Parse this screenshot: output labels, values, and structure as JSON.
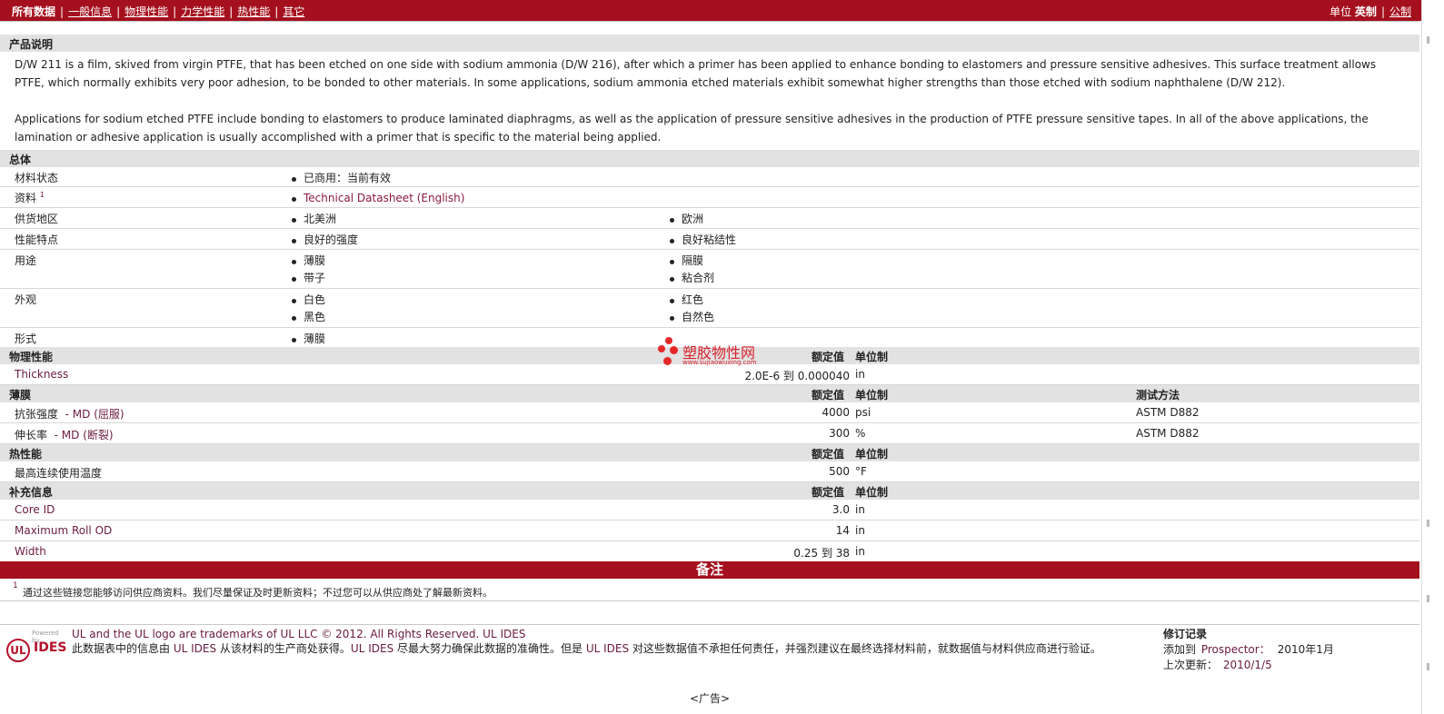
{
  "nav": {
    "all": "所有数据",
    "tabs": [
      "一般信息",
      "物理性能",
      "力学性能",
      "热性能",
      "其它"
    ],
    "unit_label": "单位",
    "unit_selected": "英制",
    "unit_other": "公制"
  },
  "description": {
    "title": "产品说明",
    "p1": "D/W 211 is a film, skived from virgin PTFE, that has been etched on one side with sodium ammonia (D/W 216), after which a primer has been applied to enhance bonding to elastomers and pressure sensitive adhesives. This surface treatment allows PTFE, which normally exhibits very poor adhesion, to be bonded to other materials. In some applications, sodium ammonia etched materials exhibit somewhat higher strengths than those etched with sodium naphthalene (D/W 212).",
    "p2": "Applications for sodium etched PTFE include bonding to elastomers to produce laminated diaphragms, as well as the application of pressure sensitive adhesives in the production of PTFE pressure sensitive tapes. In all of the above applications, the lamination or adhesive application is usually accomplished with a primer that is specific to the material being applied."
  },
  "general": {
    "title": "总体",
    "status_label": "材料状态",
    "status_value": "已商用：当前有效",
    "docs_label": "资料",
    "docs_sup": "1",
    "docs_link": "Technical Datasheet (English)",
    "region_label": "供货地区",
    "region_1": "北美洲",
    "region_2": "欧洲",
    "features_label": "性能特点",
    "features_1": "良好的强度",
    "features_2": "良好粘结性",
    "uses_label": "用途",
    "uses_1": "薄膜",
    "uses_2": "隔膜",
    "uses_3": "带子",
    "uses_4": "粘合剂",
    "appearance_label": "外观",
    "appearance_1": "白色",
    "appearance_2": "红色",
    "appearance_3": "黑色",
    "appearance_4": "自然色",
    "form_label": "形式",
    "form_1": "薄膜"
  },
  "col_headers": {
    "nominal": "额定值",
    "unit": "单位制",
    "test": "测试方法"
  },
  "physical": {
    "title": "物理性能",
    "thickness_label": "Thickness",
    "thickness_value": "2.0E-6 到  0.000040",
    "thickness_unit": "in"
  },
  "film": {
    "title": "薄膜",
    "tensile_label": "抗张强度",
    "tensile_sub": "- MD (屈服)",
    "tensile_value": "4000",
    "tensile_unit": "psi",
    "tensile_test": "ASTM D882",
    "elong_label": "伸长率",
    "elong_sub": "- MD (断裂)",
    "elong_value": "300",
    "elong_unit": "%",
    "elong_test": "ASTM D882"
  },
  "thermal": {
    "title": "热性能",
    "maxtemp_label": "最高连续使用温度",
    "maxtemp_value": "500",
    "maxtemp_unit": "°F"
  },
  "supplemental": {
    "title": "补充信息",
    "core_label": "Core ID",
    "core_value": "3.0",
    "core_unit": "in",
    "roll_label": "Maximum Roll OD",
    "roll_value": "14",
    "roll_unit": "in",
    "width_label": "Width",
    "width_value": "0.25 到  38",
    "width_unit": "in"
  },
  "notes": {
    "title": "备注",
    "sup": "1",
    "text": "通过这些链接您能够访问供应商资料。我们尽量保证及时更新资料；不过您可以从供应商处了解最新资料。"
  },
  "footer": {
    "logo_powered": "Powered by",
    "logo_ul": "UL",
    "logo_ides": "IDES",
    "trademark": "UL and the UL logo are trademarks of UL LLC © 2012. All Rights Reserved. UL IDES",
    "disc_a": "此数据表中的信息由 ",
    "disc_b": "UL IDES",
    "disc_c": " 从该材料的生产商处获得。",
    "disc_d": "UL IDES",
    "disc_e": " 尽最大努力确保此数据的准确性。但是 ",
    "disc_f": "UL IDES",
    "disc_g": " 对这些数据值不承担任何责任，并强烈建议在最终选择材料前，就数据值与材料供应商进行验证。",
    "rev_title": "修订记录",
    "rev_added_label": "添加到",
    "rev_added_link": "Prospector：",
    "rev_added_date": "2010年1月",
    "rev_updated_label": "上次更新：",
    "rev_updated_date": "2010/1/5",
    "ad": "<广告>"
  },
  "watermark": {
    "text": "塑胶物性网",
    "url": "www.sujiaowuxing.com"
  }
}
